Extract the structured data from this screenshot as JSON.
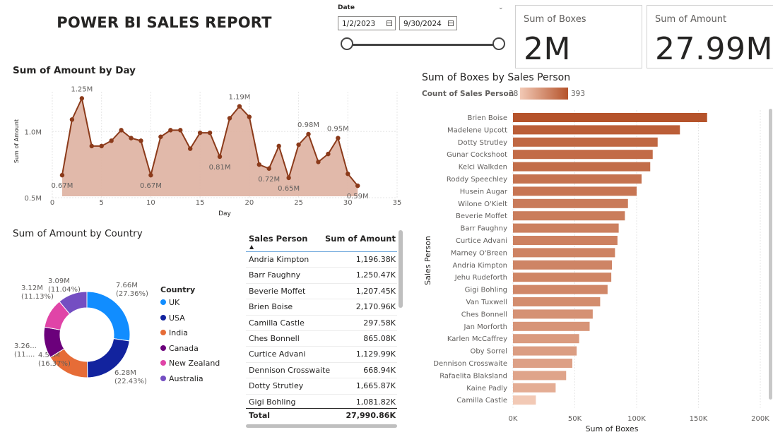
{
  "report": {
    "title": "POWER BI SALES REPORT"
  },
  "date_slicer": {
    "label": "Date",
    "start": "1/2/2023",
    "end": "9/30/2024"
  },
  "cards": [
    {
      "label": "Sum of Boxes",
      "value": "2M"
    },
    {
      "label": "Sum of Amount",
      "value": "27.99M"
    }
  ],
  "colors": {
    "area_fill": "#deb1a1",
    "area_line": "#8b3a1a",
    "bar_min": "#f2c9b5",
    "bar_max": "#b5532b",
    "uk": "#118dff",
    "usa": "#12239e",
    "india": "#e66c37",
    "canada": "#6b007b",
    "new_zealand": "#e044a7",
    "australia": "#744ec2"
  },
  "chart_data": [
    {
      "type": "area",
      "title": "Sum of Amount by Day",
      "xlabel": "Day",
      "ylabel": "Sum of Amount",
      "xlim": [
        0,
        35
      ],
      "ylim": [
        0.5,
        1.3
      ],
      "x_ticks": [
        "0",
        "5",
        "10",
        "15",
        "20",
        "25",
        "30",
        "35"
      ],
      "y_ticks": [
        {
          "v": 0.5,
          "label": "0.5M"
        },
        {
          "v": 1.0,
          "label": "1.0M"
        }
      ],
      "x": [
        1,
        2,
        3,
        4,
        5,
        6,
        7,
        8,
        9,
        10,
        11,
        12,
        13,
        14,
        15,
        16,
        17,
        18,
        19,
        20,
        21,
        22,
        23,
        24,
        25,
        26,
        27,
        28,
        29,
        30,
        31
      ],
      "values": [
        0.67,
        1.09,
        1.25,
        0.89,
        0.89,
        0.93,
        1.01,
        0.95,
        0.93,
        0.67,
        0.96,
        1.01,
        1.01,
        0.87,
        0.99,
        0.99,
        0.81,
        1.1,
        1.19,
        1.11,
        0.75,
        0.72,
        0.89,
        0.65,
        0.9,
        0.98,
        0.77,
        0.83,
        0.95,
        0.68,
        0.59
      ],
      "data_labels": [
        {
          "day": 1,
          "label": "0.67M",
          "pos": "below"
        },
        {
          "day": 3,
          "label": "1.25M",
          "pos": "above"
        },
        {
          "day": 10,
          "label": "0.67M",
          "pos": "below"
        },
        {
          "day": 17,
          "label": "0.81M",
          "pos": "below"
        },
        {
          "day": 19,
          "label": "1.19M",
          "pos": "above"
        },
        {
          "day": 22,
          "label": "0.72M",
          "pos": "below"
        },
        {
          "day": 24,
          "label": "0.65M",
          "pos": "below"
        },
        {
          "day": 26,
          "label": "0.98M",
          "pos": "above"
        },
        {
          "day": 29,
          "label": "0.95M",
          "pos": "above"
        },
        {
          "day": 31,
          "label": "0.59M",
          "pos": "below"
        }
      ],
      "grid": true
    },
    {
      "type": "pie",
      "title": "Sum of Amount by Country",
      "legend_title": "Country",
      "donut": true,
      "slices": [
        {
          "name": "UK",
          "value": 7.66,
          "label": "7.66M",
          "pct": "(27.36%)"
        },
        {
          "name": "USA",
          "value": 6.28,
          "label": "6.28M",
          "pct": "(22.43%)"
        },
        {
          "name": "India",
          "value": 4.58,
          "label": "4.58M",
          "pct": "(16.37%)"
        },
        {
          "name": "Canada",
          "value": 3.26,
          "label": "3.26...",
          "pct": "(11...."
        },
        {
          "name": "New Zealand",
          "value": 3.12,
          "label": "3.12M",
          "pct": "(11.13%)"
        },
        {
          "name": "Australia",
          "value": 3.09,
          "label": "3.09M",
          "pct": "(11.04%)"
        }
      ]
    },
    {
      "type": "table",
      "columns": [
        "Sales Person",
        "Sum of Amount"
      ],
      "rows": [
        [
          "Andria Kimpton",
          "1,196.38K"
        ],
        [
          "Barr Faughny",
          "1,250.47K"
        ],
        [
          "Beverie Moffet",
          "1,207.45K"
        ],
        [
          "Brien Boise",
          "2,170.96K"
        ],
        [
          "Camilla Castle",
          "297.58K"
        ],
        [
          "Ches Bonnell",
          "865.08K"
        ],
        [
          "Curtice Advani",
          "1,129.99K"
        ],
        [
          "Dennison Crosswaite",
          "668.94K"
        ],
        [
          "Dotty Strutley",
          "1,665.87K"
        ],
        [
          "Gigi Bohling",
          "1,081.82K"
        ]
      ],
      "total": [
        "Total",
        "27,990.86K"
      ]
    },
    {
      "type": "bar",
      "orientation": "horizontal",
      "title": "Sum of Boxes by Sales Person",
      "color_legend": {
        "label": "Count of Sales Person",
        "min": "38",
        "max": "393"
      },
      "xlabel": "Sum of Boxes",
      "ylabel": "Sales Person",
      "xlim": [
        0,
        200000
      ],
      "x_ticks": [
        {
          "v": 0,
          "label": "0K"
        },
        {
          "v": 50000,
          "label": "50K"
        },
        {
          "v": 100000,
          "label": "100K"
        },
        {
          "v": 150000,
          "label": "150K"
        },
        {
          "v": 200000,
          "label": "200K"
        }
      ],
      "categories": [
        "Brien Boise",
        "Madelene Upcott",
        "Dotty Strutley",
        "Gunar Cockshoot",
        "Kelci Walkden",
        "Roddy Speechley",
        "Husein Augar",
        "Wilone O'Kielt",
        "Beverie Moffet",
        "Barr Faughny",
        "Curtice Advani",
        "Marney O'Breen",
        "Andria Kimpton",
        "Jehu Rudeforth",
        "Gigi Bohling",
        "Van Tuxwell",
        "Ches Bonnell",
        "Jan Morforth",
        "Karlen McCaffrey",
        "Oby Sorrel",
        "Dennison Crosswaite",
        "Rafaelita Blaksland",
        "Kaine Padly",
        "Camilla Castle"
      ],
      "values": [
        157000,
        135000,
        117000,
        113000,
        111000,
        104000,
        100000,
        93000,
        90500,
        85500,
        84500,
        82500,
        80000,
        79500,
        76500,
        70500,
        64500,
        62000,
        53500,
        51500,
        48000,
        43000,
        34500,
        18500
      ],
      "counts": [
        393,
        360,
        330,
        320,
        315,
        300,
        290,
        275,
        268,
        258,
        255,
        250,
        245,
        243,
        236,
        220,
        205,
        198,
        176,
        170,
        160,
        148,
        122,
        38
      ]
    }
  ]
}
